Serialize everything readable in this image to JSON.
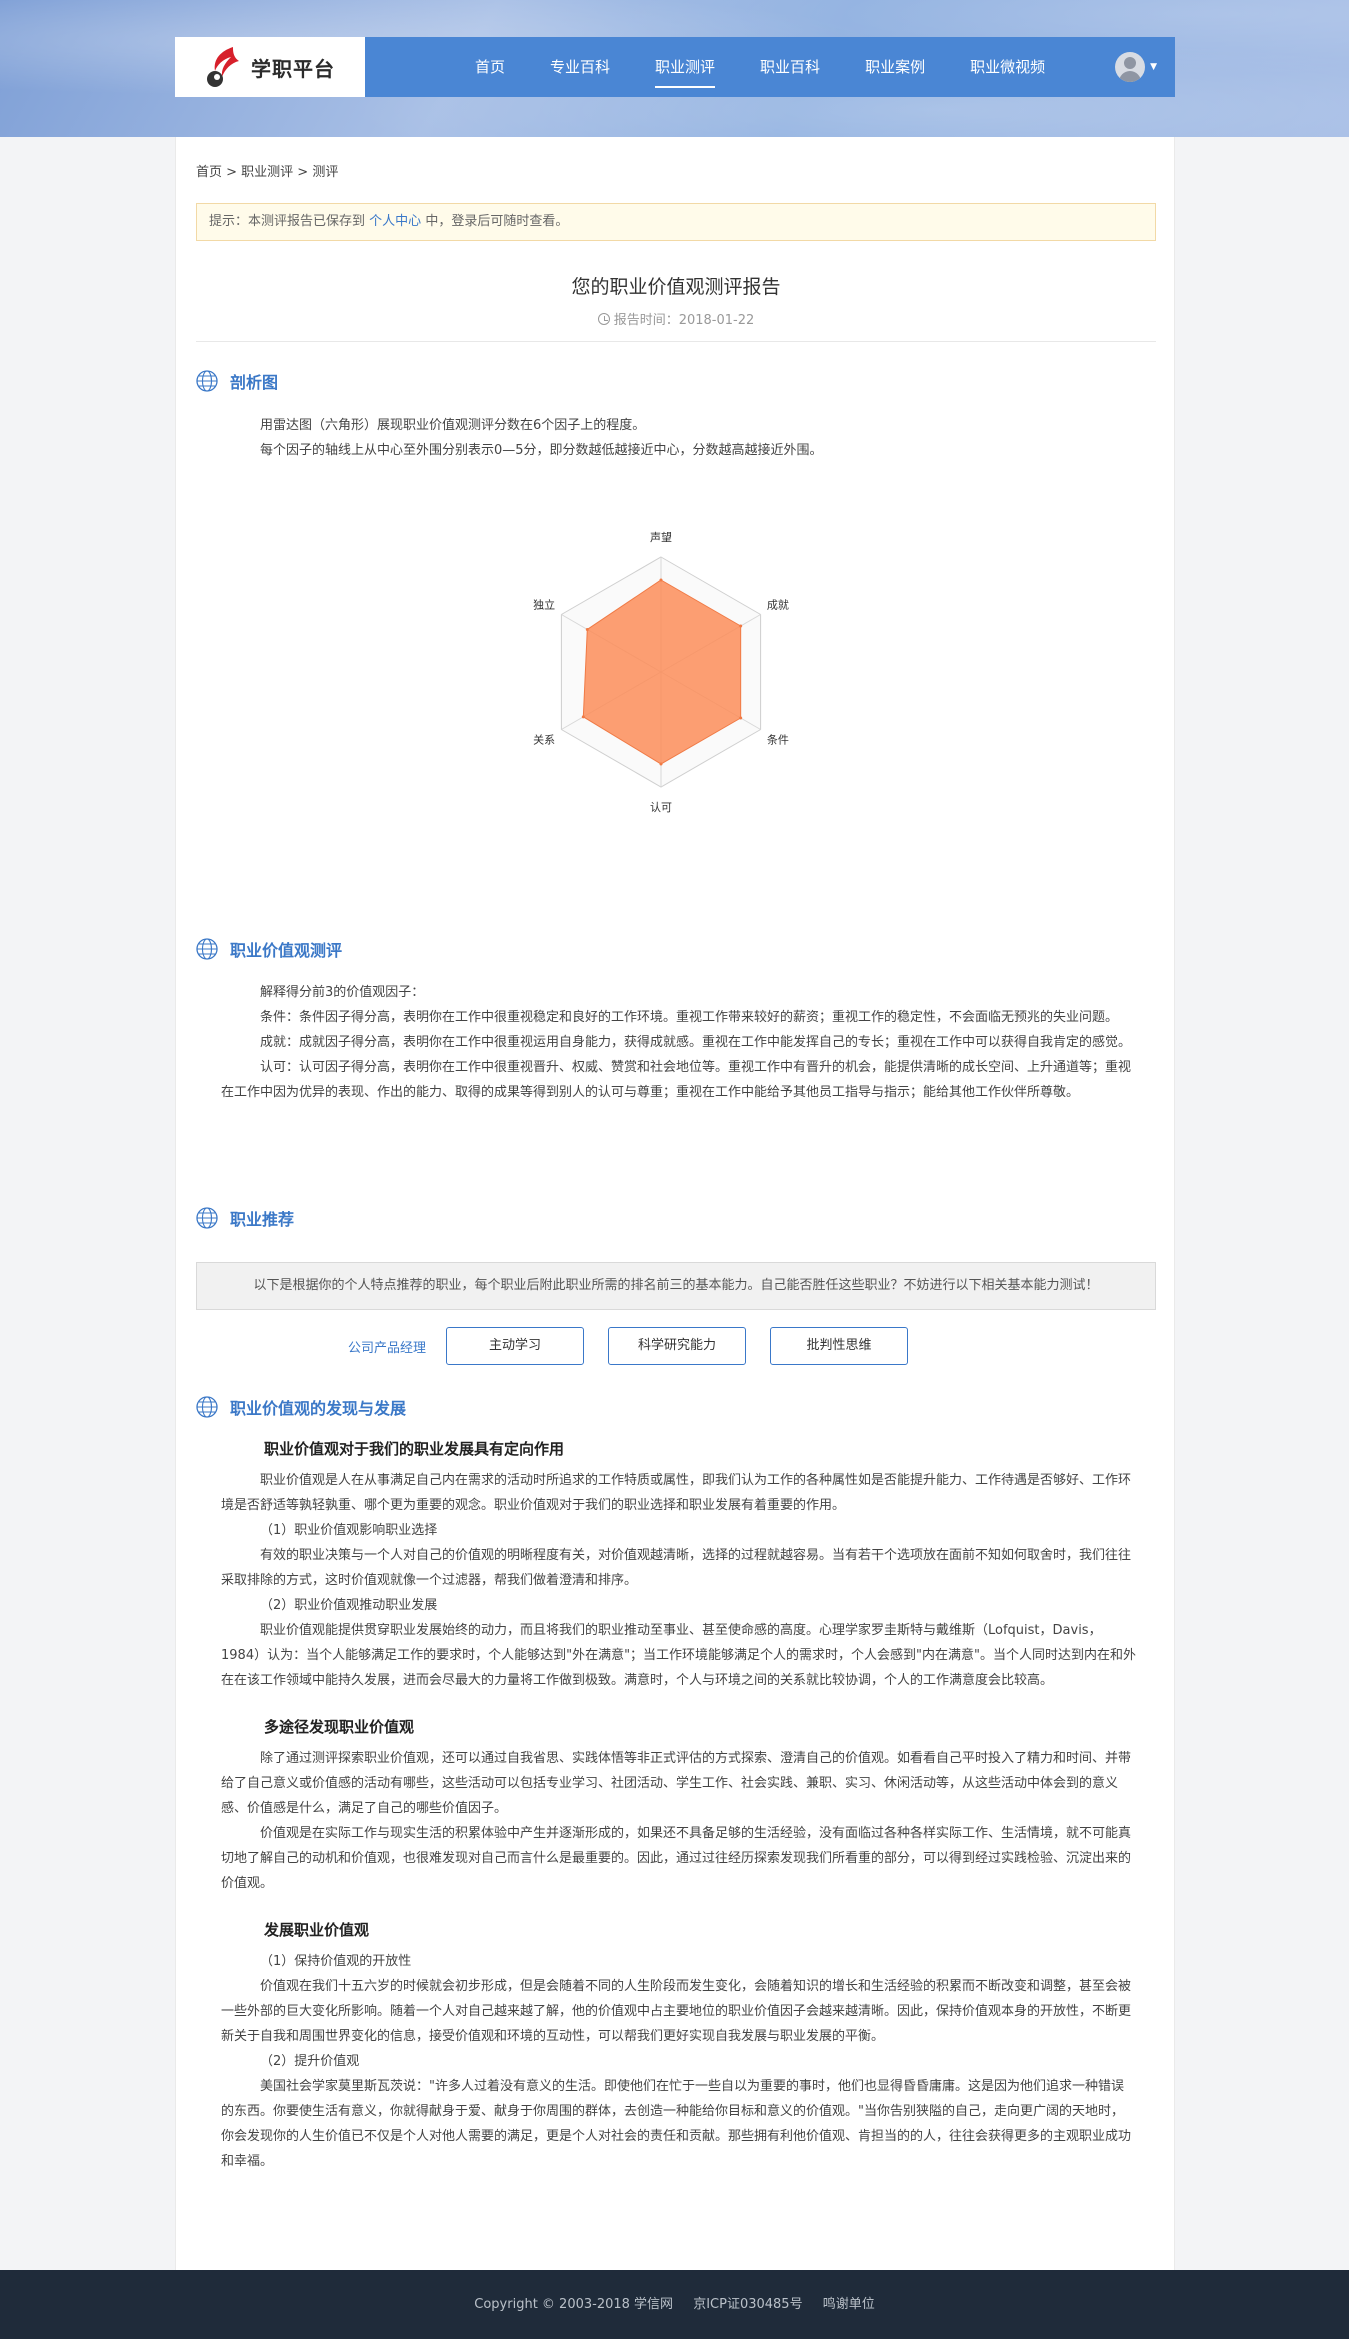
{
  "site": {
    "logo_text": "学职平台"
  },
  "nav": [
    "首页",
    "专业百科",
    "职业测评",
    "职业百科",
    "职业案例",
    "职业微视频"
  ],
  "breadcrumb": "首页 > 职业测评 > 测评",
  "tip": {
    "prefix": "提示：本测评报告已保存到",
    "link": "个人中心",
    "suffix": "中，登录后可随时查看。"
  },
  "report": {
    "title": "您的职业价值观测评报告",
    "time": "报告时间：2018-01-22"
  },
  "sections": {
    "radar_title": "剖析图",
    "radar_desc": [
      "用雷达图（六角形）展现职业价值观测评分数在6个因子上的程度。",
      "每个因子的轴线上从中心至外围分别表示0—5分，即分数越低越接近中心，分数越高越接近外围。"
    ],
    "eval_title": "职业价值观测评",
    "eval_intro": "解释得分前3的价值观因子：",
    "eval_items": [
      "条件：条件因子得分高，表明你在工作中很重视稳定和良好的工作环境。重视工作带来较好的薪资；重视工作的稳定性，不会面临无预兆的失业问题。",
      "成就：成就因子得分高，表明你在工作中很重视运用自身能力，获得成就感。重视在工作中能发挥自己的专长；重视在工作中可以获得自我肯定的感觉。",
      "认可：认可因子得分高，表明你在工作中很重视晋升、权威、赞赏和社会地位等。重视工作中有晋升的机会，能提供清晰的成长空间、上升通道等；重视在工作中因为优异的表现、作出的能力、取得的成果等得到别人的认可与尊重；重视在工作中能给予其他员工指导与指示；能给其他工作伙伴所尊敬。"
    ],
    "rec_title": "职业推荐",
    "rec_notice": "以下是根据你的个人特点推荐的职业，每个职业后附此职业所需的排名前三的基本能力。自己能否胜任这些职业？不妨进行以下相关基本能力测试！",
    "rec_job": "公司产品经理",
    "rec_abilities": [
      "主动学习",
      "科学研究能力",
      "批判性思维"
    ],
    "dev_title": "职业价值观的发现与发展",
    "dev_h1": "职业价值观对于我们的职业发展具有定向作用",
    "dev_p1": "职业价值观是人在从事满足自己内在需求的活动时所追求的工作特质或属性，即我们认为工作的各种属性如是否能提升能力、工作待遇是否够好、工作环境是否舒适等孰轻孰重、哪个更为重要的观念。职业价值观对于我们的职业选择和职业发展有着重要的作用。",
    "dev_s1": "（1）职业价值观影响职业选择",
    "dev_p2": "有效的职业决策与一个人对自己的价值观的明晰程度有关，对价值观越清晰，选择的过程就越容易。当有若干个选项放在面前不知如何取舍时，我们往往采取排除的方式，这时价值观就像一个过滤器，帮我们做着澄清和排序。",
    "dev_s2": "（2）职业价值观推动职业发展",
    "dev_p3": "职业价值观能提供贯穿职业发展始终的动力，而且将我们的职业推动至事业、甚至使命感的高度。心理学家罗圭斯特与戴维斯（Lofquist，Davis，1984）认为：当个人能够满足工作的要求时，个人能够达到\"外在满意\"；当工作环境能够满足个人的需求时，个人会感到\"内在满意\"。当个人同时达到内在和外在在该工作领域中能持久发展，进而会尽最大的力量将工作做到极致。满意时，个人与环境之间的关系就比较协调，个人的工作满意度会比较高。",
    "dev_h2": "多途径发现职业价值观",
    "dev_p4": "除了通过测评探索职业价值观，还可以通过自我省思、实践体悟等非正式评估的方式探索、澄清自己的价值观。如看看自己平时投入了精力和时间、并带给了自己意义或价值感的活动有哪些，这些活动可以包括专业学习、社团活动、学生工作、社会实践、兼职、实习、休闲活动等，从这些活动中体会到的意义感、价值感是什么，满足了自己的哪些价值因子。",
    "dev_p5": "价值观是在实际工作与现实生活的积累体验中产生并逐渐形成的，如果还不具备足够的生活经验，没有面临过各种各样实际工作、生活情境，就不可能真切地了解自己的动机和价值观，也很难发现对自己而言什么是最重要的。因此，通过过往经历探索发现我们所看重的部分，可以得到经过实践检验、沉淀出来的价值观。",
    "dev_h3": "发展职业价值观",
    "dev_s3": "（1）保持价值观的开放性",
    "dev_p6": "价值观在我们十五六岁的时候就会初步形成，但是会随着不同的人生阶段而发生变化，会随着知识的增长和生活经验的积累而不断改变和调整，甚至会被一些外部的巨大变化所影响。随着一个人对自己越来越了解，他的价值观中占主要地位的职业价值因子会越来越清晰。因此，保持价值观本身的开放性，不断更新关于自我和周围世界变化的信息，接受价值观和环境的互动性，可以帮我们更好实现自我发展与职业发展的平衡。",
    "dev_s4": "（2）提升价值观",
    "dev_p7": "美国社会学家莫里斯瓦茨说：\"许多人过着没有意义的生活。即使他们在忙于一些自以为重要的事时，他们也显得昏昏庸庸。这是因为他们追求一种错误的东西。你要使生活有意义，你就得献身于爱、献身于你周围的群体，去创造一种能给你目标和意义的价值观。\"当你告别狭隘的自己，走向更广阔的天地时，你会发现你的人生价值已不仅是个人对他人需要的满足，更是个人对社会的责任和贡献。那些拥有利他价值观、肯担当的的人，往往会获得更多的主观职业成功和幸福。"
  },
  "chart_data": {
    "type": "radar",
    "axis_labels": [
      "声望",
      "成就",
      "条件",
      "认可",
      "关系",
      "独立"
    ],
    "scale": [
      0,
      5
    ],
    "values": [
      4.0,
      4.0,
      4.0,
      4.0,
      3.9,
      3.7
    ],
    "fill_color": "#fc8d59"
  },
  "footer": {
    "copyright": "Copyright © 2003-2018 学信网",
    "icp": "京ICP证030485号",
    "host": "鸣谢单位"
  },
  "colors": {
    "header_blue": "#4a86d4",
    "link_blue": "#3a78c9",
    "footer_bg": "#1f2b3a"
  }
}
